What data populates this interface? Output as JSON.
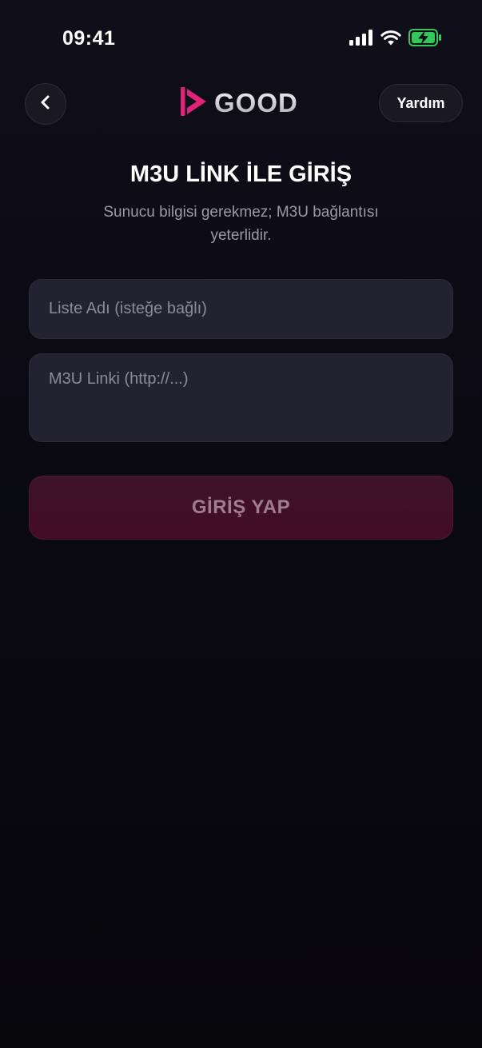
{
  "status_bar": {
    "time": "09:41"
  },
  "header": {
    "back_icon": "chevron-left-icon",
    "logo_text": "GOOD",
    "logo_icon": "play-logo-icon",
    "help_label": "Yardım"
  },
  "main": {
    "title": "M3U LİNK İLE GİRİŞ",
    "subtitle": "Sunucu bilgisi gerekmez; M3U bağlantısı yeterlidir.",
    "list_name_placeholder": "Liste Adı (isteğe bağlı)",
    "list_name_value": "",
    "m3u_link_placeholder": "M3U Linki (http://...)",
    "m3u_link_value": "",
    "login_label": "GİRİŞ YAP"
  },
  "colors": {
    "background": "#0b0a12",
    "field_background": "#232231",
    "accent_pink": "#e0237a",
    "button_background": "#3f1027",
    "battery_green": "#34c759"
  }
}
